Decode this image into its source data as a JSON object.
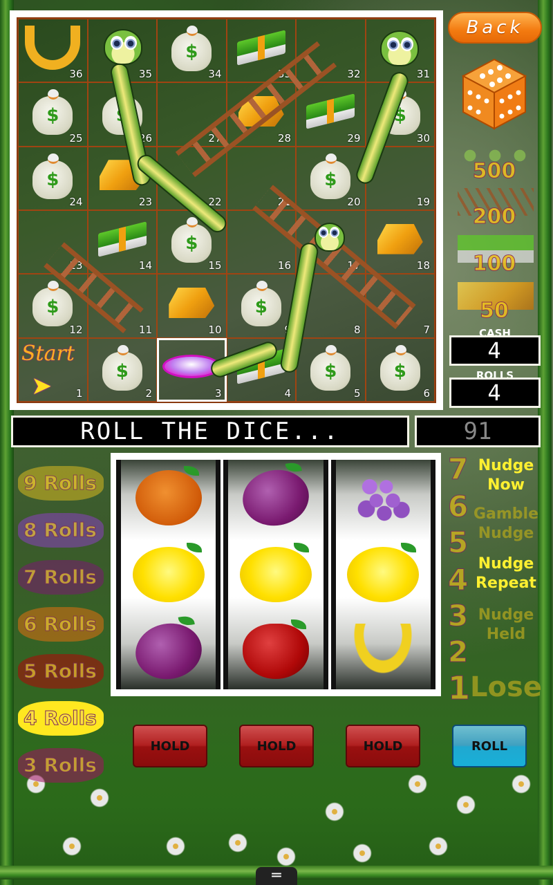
{
  "header": {
    "back_label": "Back"
  },
  "board": {
    "rows": [
      [
        {
          "n": "36",
          "item": "horseshoe"
        },
        {
          "n": "35",
          "item": "snake-head"
        },
        {
          "n": "34",
          "item": "money-bag"
        },
        {
          "n": "33",
          "item": "cash-stack"
        },
        {
          "n": "32",
          "item": ""
        },
        {
          "n": "31",
          "item": "snake-head"
        }
      ],
      [
        {
          "n": "25",
          "item": "money-bag"
        },
        {
          "n": "26",
          "item": "money-bag"
        },
        {
          "n": "27",
          "item": ""
        },
        {
          "n": "28",
          "item": "gold-bars"
        },
        {
          "n": "29",
          "item": "cash-stack"
        },
        {
          "n": "30",
          "item": "money-bag"
        }
      ],
      [
        {
          "n": "24",
          "item": "money-bag"
        },
        {
          "n": "23",
          "item": "gold-bars"
        },
        {
          "n": "22",
          "item": ""
        },
        {
          "n": "21",
          "item": ""
        },
        {
          "n": "20",
          "item": "money-bag"
        },
        {
          "n": "19",
          "item": ""
        }
      ],
      [
        {
          "n": "13",
          "item": ""
        },
        {
          "n": "14",
          "item": "cash-stack"
        },
        {
          "n": "15",
          "item": "money-bag"
        },
        {
          "n": "16",
          "item": ""
        },
        {
          "n": "17",
          "item": ""
        },
        {
          "n": "18",
          "item": "gold-bars"
        }
      ],
      [
        {
          "n": "12",
          "item": "money-bag"
        },
        {
          "n": "11",
          "item": ""
        },
        {
          "n": "10",
          "item": "gold-bars"
        },
        {
          "n": "9",
          "item": "money-bag"
        },
        {
          "n": "8",
          "item": ""
        },
        {
          "n": "7",
          "item": ""
        }
      ],
      [
        {
          "n": "1",
          "item": "start"
        },
        {
          "n": "2",
          "item": "money-bag"
        },
        {
          "n": "3",
          "item": "player-token"
        },
        {
          "n": "4",
          "item": "cash-stack"
        },
        {
          "n": "5",
          "item": "money-bag"
        },
        {
          "n": "6",
          "item": "money-bag"
        }
      ]
    ],
    "start_label": "Start",
    "current_square": "3"
  },
  "prizes": [
    {
      "icon": "snakes",
      "value": "500"
    },
    {
      "icon": "ladders",
      "value": "200"
    },
    {
      "icon": "cash-stacks",
      "value": "100"
    },
    {
      "icon": "gold-bars",
      "value": "50"
    }
  ],
  "counters": {
    "cash_label": "CASH",
    "cash_value": "4",
    "rolls_label": "ROLLS",
    "rolls_value": "4"
  },
  "message": "ROLL THE DICE...",
  "score": "91",
  "reels": [
    [
      "orange",
      "lemon",
      "plum"
    ],
    [
      "plum",
      "lemon",
      "apple"
    ],
    [
      "grapes",
      "lemon",
      "banana"
    ]
  ],
  "paytable": [
    {
      "fruit": "banana",
      "label": "9 Rolls",
      "active": false
    },
    {
      "fruit": "grapes",
      "label": "8 Rolls",
      "active": false
    },
    {
      "fruit": "plum",
      "label": "7 Rolls",
      "active": false
    },
    {
      "fruit": "orange",
      "label": "6 Rolls",
      "active": false
    },
    {
      "fruit": "apple",
      "label": "5 Rolls",
      "active": false
    },
    {
      "fruit": "lemon",
      "label": "4 Rolls",
      "active": true
    },
    {
      "fruit": "cherry",
      "label": "3 Rolls",
      "active": false
    }
  ],
  "nudge_table": {
    "numbers": [
      "7",
      "6",
      "5",
      "4",
      "3",
      "2",
      "1"
    ],
    "labels": [
      {
        "text": "Nudge Now",
        "lit": true
      },
      {
        "text": "Gamble",
        "lit": false
      },
      {
        "text": "Nudge",
        "lit": false
      },
      {
        "text": "Nudge Repeat",
        "lit": true
      },
      {
        "text": "Nudge Held",
        "lit": false
      },
      {
        "text": "Lose",
        "lit": false
      }
    ]
  },
  "buttons": {
    "hold_label": "HOLD",
    "roll_label": "ROLL"
  },
  "colors": {
    "back_button": "#f37a10",
    "hold_button": "#b02020",
    "roll_button": "#20a8d0",
    "token": "#e020d0"
  }
}
